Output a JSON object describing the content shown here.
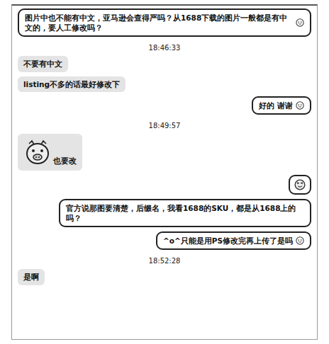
{
  "messages": [
    {
      "kind": "bubble",
      "side": "right",
      "text": "图片中也不能有中文，亚马逊会查得严吗？从1688下载的图片一般都是有中文的，要人工修改吗？",
      "emoji": true
    },
    {
      "kind": "time",
      "text": "18:46:33"
    },
    {
      "kind": "bubble",
      "side": "left",
      "text": "不要有中文",
      "emoji": false
    },
    {
      "kind": "bubble",
      "side": "left",
      "text": "listing不多的话最好修改下",
      "emoji": false
    },
    {
      "kind": "bubble",
      "side": "right",
      "text": "好的 谢谢",
      "emoji": true
    },
    {
      "kind": "time",
      "text": "18:49:57"
    },
    {
      "kind": "sticker",
      "side": "left",
      "caption": "也要改"
    },
    {
      "kind": "emoji",
      "side": "right"
    },
    {
      "kind": "bubble",
      "side": "right",
      "text": "官方说那图要清楚，后缀名，我看1688的SKU，都是从1688上的吗？",
      "emoji": false
    },
    {
      "kind": "bubble",
      "side": "right",
      "text": "^o^只能是用PS修改完再上传了是吗",
      "emoji": true
    },
    {
      "kind": "time",
      "text": "18:52:28"
    },
    {
      "kind": "bubble",
      "side": "left",
      "text": "是啊",
      "emoji": false
    }
  ]
}
